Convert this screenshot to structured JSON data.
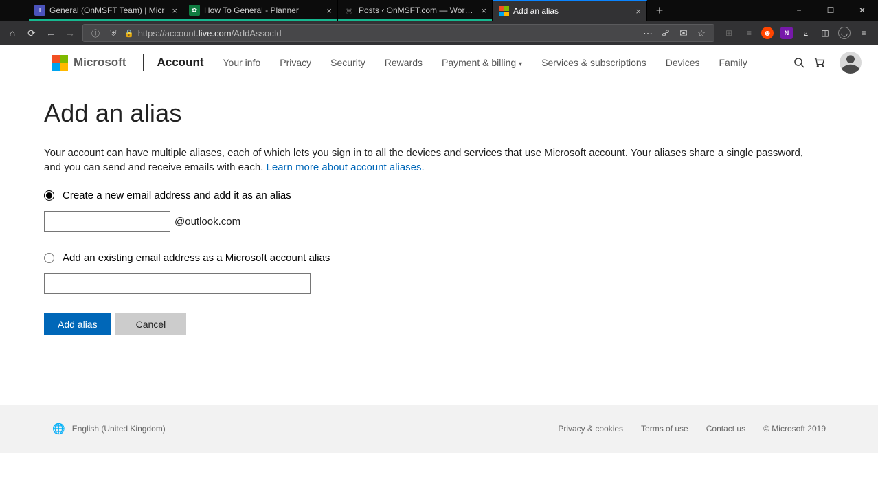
{
  "browser": {
    "tabs": [
      {
        "title": "General (OnMSFT Team) | Micr",
        "active": false
      },
      {
        "title": "How To General - Planner",
        "active": false
      },
      {
        "title": "Posts ‹ OnMSFT.com — WordPress",
        "active": false
      },
      {
        "title": "Add an alias",
        "active": true
      }
    ],
    "url_prefix": "https://account.",
    "url_host": "live.com",
    "url_path": "/AddAssocId"
  },
  "header": {
    "brand": "Microsoft",
    "current": "Account",
    "nav": [
      "Your info",
      "Privacy",
      "Security",
      "Rewards",
      "Payment & billing",
      "Services & subscriptions",
      "Devices",
      "Family"
    ]
  },
  "page": {
    "title": "Add an alias",
    "intro_a": "Your account can have multiple aliases, each of which lets you sign in to all the devices and services that use Microsoft account. Your aliases share a single password, and you can send and receive emails with each. ",
    "intro_link": "Learn more about account aliases.",
    "radio_create": "Create a new email address and add it as an alias",
    "email_suffix": "@outlook.com",
    "radio_existing": "Add an existing email address as a Microsoft account alias",
    "btn_add": "Add alias",
    "btn_cancel": "Cancel"
  },
  "footer": {
    "language": "English (United Kingdom)",
    "links": [
      "Privacy & cookies",
      "Terms of use",
      "Contact us"
    ],
    "copyright": "© Microsoft 2019"
  }
}
